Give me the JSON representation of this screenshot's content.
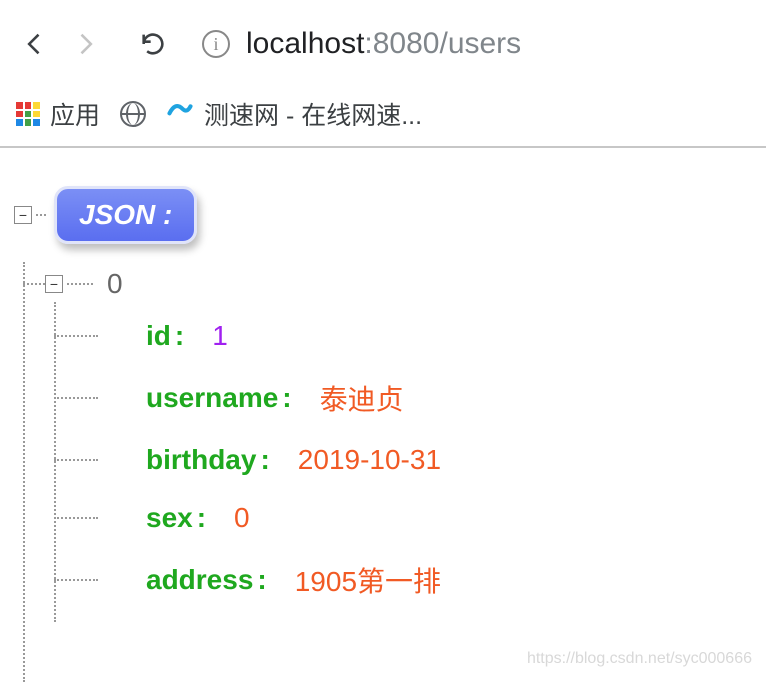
{
  "url": {
    "host": "localhost",
    "port_path": ":8080/users"
  },
  "bookmarks": {
    "apps_label": "应用",
    "speedtest_label": "测速网 - 在线网速..."
  },
  "tree": {
    "root_label": "JSON :",
    "items": [
      {
        "index": "0",
        "props": [
          {
            "key": "id",
            "value": "1",
            "type": "number"
          },
          {
            "key": "username",
            "value": "泰迪贞",
            "type": "string"
          },
          {
            "key": "birthday",
            "value": "2019-10-31",
            "type": "string"
          },
          {
            "key": "sex",
            "value": "0",
            "type": "string"
          },
          {
            "key": "address",
            "value": "1905第一排",
            "type": "string"
          }
        ]
      }
    ]
  },
  "watermark": "https://blog.csdn.net/syc000666"
}
